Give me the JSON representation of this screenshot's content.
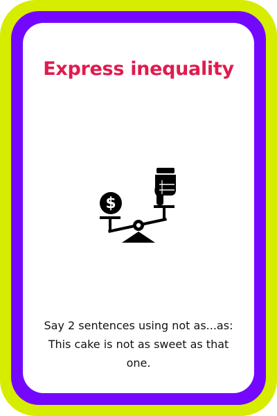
{
  "card": {
    "title": "Express inequality",
    "illustration_icon": "balance-scale-money-vs-hand-icon",
    "instruction_lines": [
      "Say 2 sentences using not as...as:",
      "This cake is not as sweet as that",
      "one."
    ]
  },
  "colors": {
    "outer_border": "#d6ec00",
    "inner_border": "#7408ff",
    "card_background": "#ffffff",
    "title": "#e01b4e",
    "text": "#111111"
  }
}
